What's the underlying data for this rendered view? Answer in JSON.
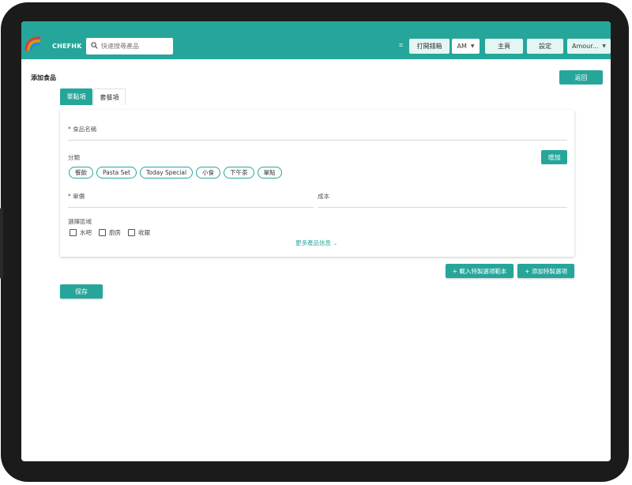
{
  "header": {
    "brand": "CHEFHK",
    "search_placeholder": "快速搜尋產品",
    "grid_icon_glyph": "⌗",
    "open_drawer_label": "打開錢箱",
    "ampm_value": "AM",
    "home_label": "主頁",
    "settings_label": "設定",
    "user_label": "Amour..."
  },
  "page": {
    "title": "添加食品",
    "back_label": "返回"
  },
  "tabs": [
    {
      "label": "單點項",
      "active": true
    },
    {
      "label": "套餐項",
      "active": false
    }
  ],
  "form": {
    "food_name_label": "* 食品名稱",
    "category_label": "分類",
    "add_label": "增加",
    "categories": [
      "餐飲",
      "Pasta Set",
      "Today Special",
      "小食",
      "下午茶",
      "單點"
    ],
    "price_label": "* 單價",
    "cost_label": "成本",
    "print_area_label": "選擇區域",
    "areas": [
      "水吧",
      "廚房",
      "收銀"
    ],
    "more_label": "更多產品信息"
  },
  "actions": {
    "import_template_label": "+ 載入特製選項範本",
    "add_option_label": "+ 添加特製選項",
    "save_label": "保存"
  },
  "colors": {
    "accent": "#26a69a",
    "accent_light": "#e4f6f3"
  }
}
